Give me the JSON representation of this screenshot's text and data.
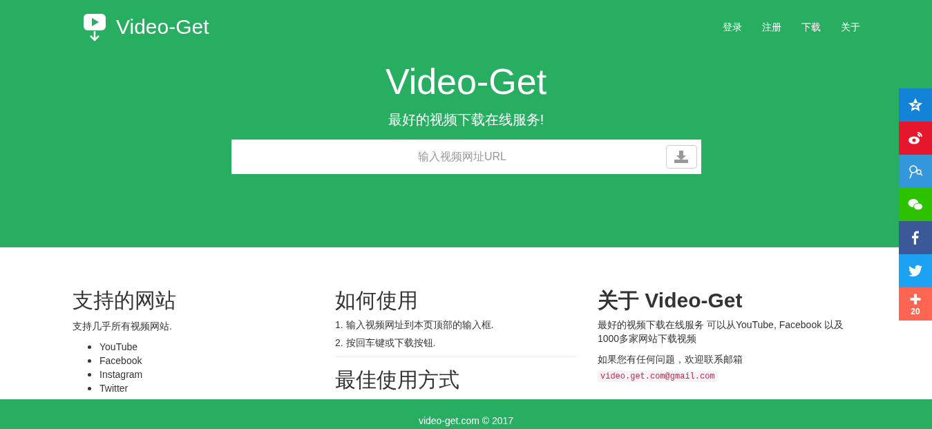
{
  "brand": {
    "name": "Video-Get"
  },
  "nav": [
    "登录",
    "注册",
    "下载",
    "关于"
  ],
  "hero": {
    "title": "Video-Get",
    "subtitle": "最好的视频下载在线服务!",
    "search": {
      "placeholder": "输入视频网址URL"
    }
  },
  "share": [
    {
      "kind": "qzone",
      "color": "#1283d6"
    },
    {
      "kind": "weibo",
      "color": "#e6162d"
    },
    {
      "kind": "tqq",
      "color": "#3497db"
    },
    {
      "kind": "wechat",
      "color": "#2dc100"
    },
    {
      "kind": "facebook",
      "color": "#3b5998"
    },
    {
      "kind": "twitter",
      "color": "#1da1f2"
    },
    {
      "kind": "more",
      "color": "#ff6550",
      "count": "20"
    }
  ],
  "sites": {
    "heading": "支持的网站",
    "text": "支持几乎所有视频网站.",
    "items": [
      "YouTube",
      "Facebook",
      "Instagram",
      "Twitter"
    ]
  },
  "howto": {
    "heading": "如何使用",
    "steps": [
      "1. 输入视频网址到本页顶部的输入框.",
      "2. 按回车键或下载按钮."
    ],
    "next_heading": "最佳使用方式"
  },
  "about": {
    "heading": "关于 Video-Get",
    "text": "最好的视频下载在线服务 可以从YouTube, Facebook 以及1000多家网站下载视频",
    "contact": "如果您有任何问题，欢迎联系邮箱",
    "email": "video.get.com@gmail.com"
  },
  "footer": "video-get.com © 2017"
}
